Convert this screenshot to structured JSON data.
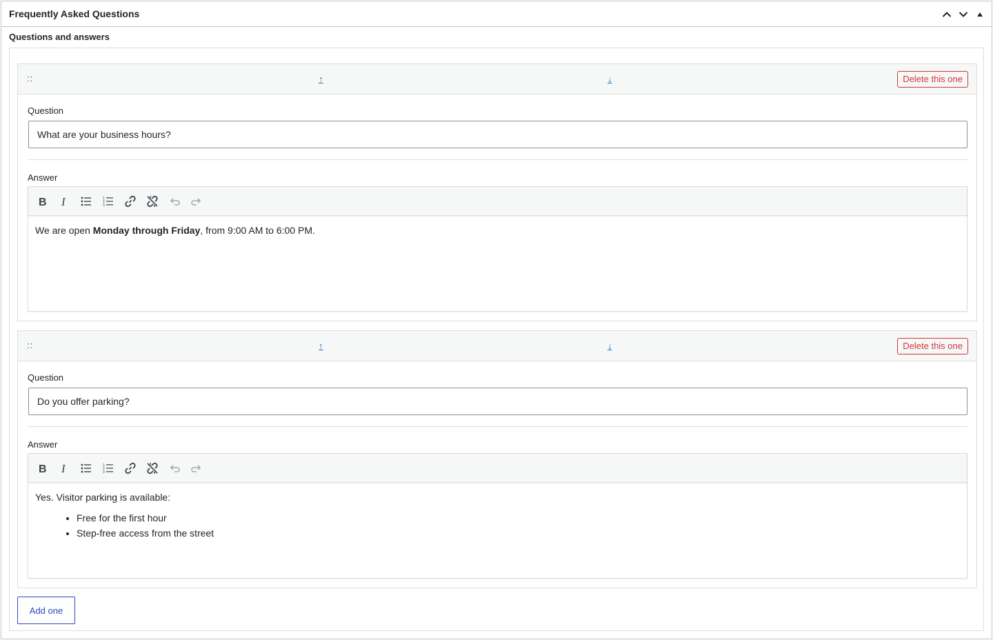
{
  "metabox": {
    "title": "Frequently Asked Questions"
  },
  "field": {
    "label": "Questions and answers"
  },
  "items": [
    {
      "handle": "::",
      "move_up": "↑",
      "move_down": "↓",
      "delete_label": "Delete this one",
      "question_label": "Question",
      "question_value": "What are your business hours?",
      "answer_label": "Answer",
      "answer": {
        "before": "We are open ",
        "bold": "Monday through Friday",
        "after": ", from 9:00 AM to 6:00 PM."
      }
    },
    {
      "handle": "::",
      "move_up": "↑",
      "move_down": "↓",
      "delete_label": "Delete this one",
      "question_label": "Question",
      "question_value": "Do you offer parking?",
      "answer_label": "Answer",
      "answer": {
        "intro": "Yes. Visitor parking is available:",
        "bullets": [
          "Free for the first hour",
          "Step-free access from the street"
        ]
      }
    }
  ],
  "add_label": "Add one",
  "toolbar_icons": [
    "bold-icon",
    "italic-icon",
    "bullet-list-icon",
    "numbered-list-icon",
    "link-icon",
    "unlink-icon",
    "undo-icon",
    "redo-icon"
  ],
  "colors": {
    "link": "#2271b1",
    "danger": "#d63638",
    "primary": "#2c4ab8"
  }
}
